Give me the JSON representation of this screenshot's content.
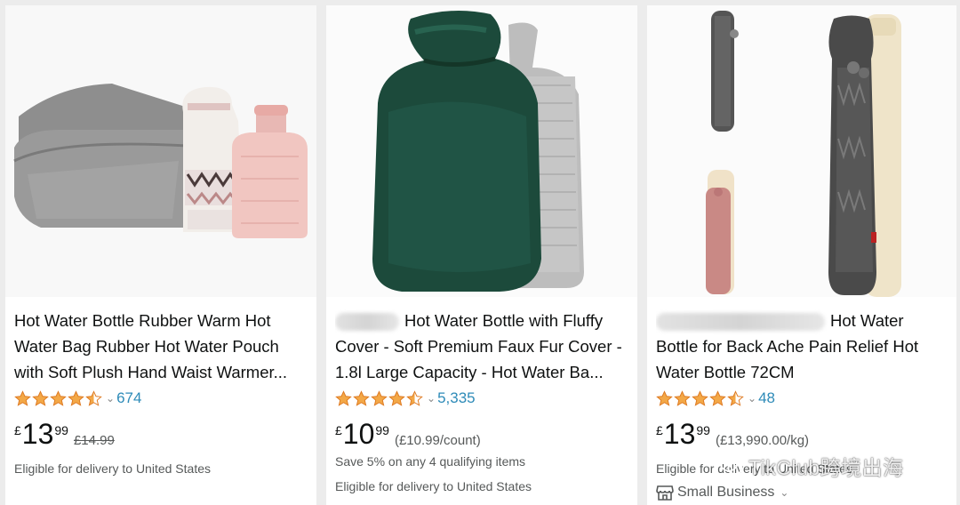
{
  "products": [
    {
      "title": "Hot Water Bottle Rubber Warm Hot Water Bag Rubber Hot Water Pouch with Soft Plush Hand Waist Warmer...",
      "rating": 4.5,
      "review_count": "674",
      "price_currency": "£",
      "price_whole": "13",
      "price_fraction": "99",
      "was_price": "£14.99",
      "delivery": "Eligible for delivery to United States"
    },
    {
      "title": "Hot Water Bottle with Fluffy Cover - Soft Premium Faux Fur Cover - 1.8l Large Capacity - Hot Water Ba...",
      "rating": 4.5,
      "review_count": "5,335",
      "price_currency": "£",
      "price_whole": "10",
      "price_fraction": "99",
      "unit_price": "(£10.99/count)",
      "promo": "Save 5% on any 4 qualifying items",
      "delivery": "Eligible for delivery to United States"
    },
    {
      "title": "Hot Water Bottle for Back Ache Pain Relief Hot Water Bottle 72CM",
      "rating": 4.5,
      "review_count": "48",
      "price_currency": "£",
      "price_whole": "13",
      "price_fraction": "99",
      "unit_price": "(£13,990.00/kg)",
      "delivery": "Eligible for delivery to United States",
      "badge": "Small Business"
    }
  ],
  "watermark": "TikClub跨境出海",
  "colors": {
    "star": "#f3a847",
    "link": "#2e8bb8",
    "muted": "#565959"
  },
  "icons": {
    "rating_dropdown": "chevron-down-icon",
    "small_business": "storefront-icon",
    "watermark": "wechat-icon"
  }
}
